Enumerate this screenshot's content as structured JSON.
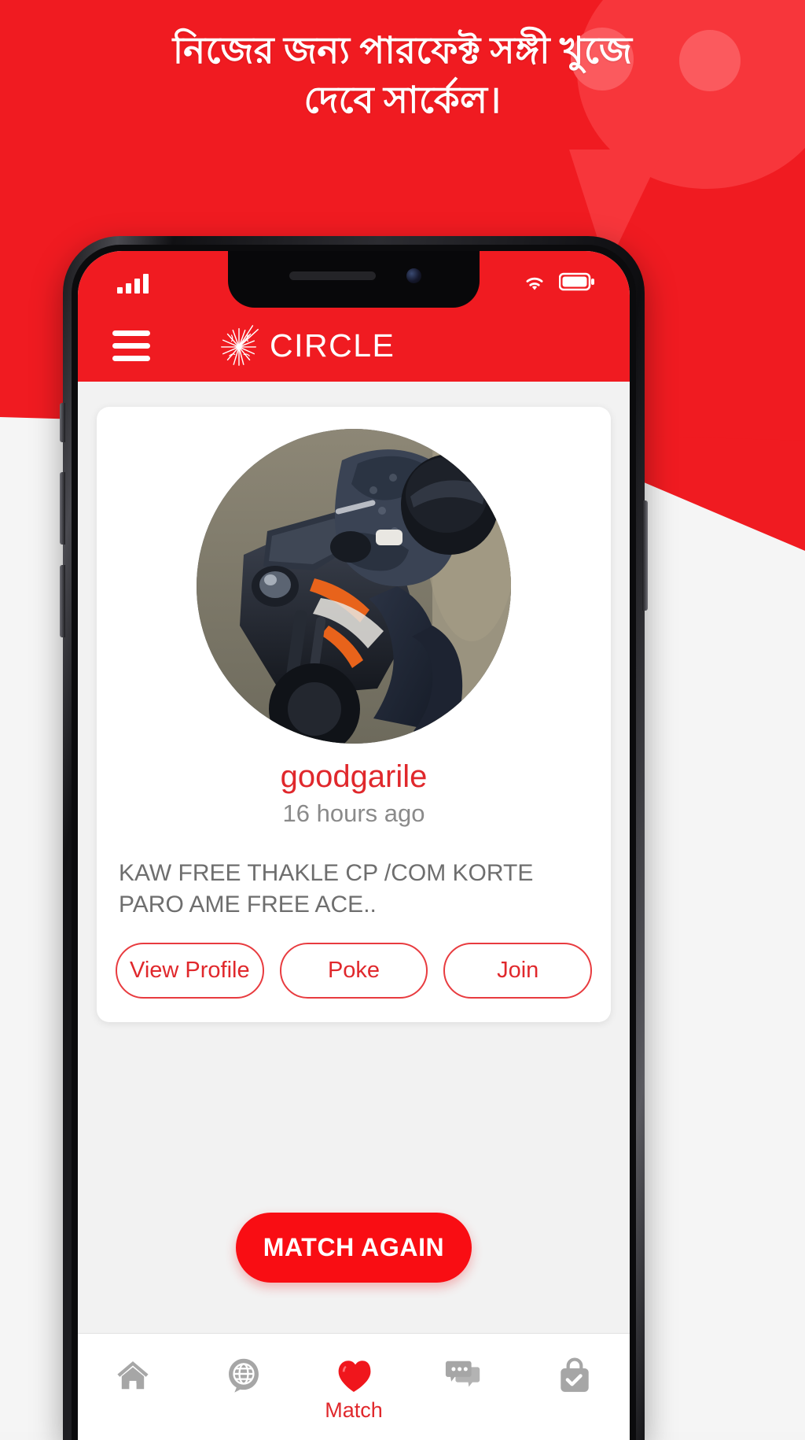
{
  "promo": {
    "headline_line1": "নিজের জন্য পারফেক্ট সঙ্গী খুজে",
    "headline_line2": "দেবে সার্কেল।",
    "background_color": "#f01b21",
    "accent_color": "#e0282c"
  },
  "statusbar": {
    "signal_icon": "signal-bars-icon",
    "wifi_icon": "wifi-icon",
    "battery_icon": "battery-full-icon"
  },
  "appbar": {
    "menu_icon": "hamburger-menu-icon",
    "logo_icon": "circle-starburst-logo-icon",
    "brand_name": "CIRCLE"
  },
  "card": {
    "avatar_alt": "motorcycle-rider-photo",
    "username": "goodgarile",
    "timestamp": "16 hours ago",
    "status_text": "KAW FREE THAKLE CP /COM KORTE PARO AME FREE ACE..",
    "buttons": [
      {
        "label": "View Profile",
        "name": "view-profile-button"
      },
      {
        "label": "Poke",
        "name": "poke-button"
      },
      {
        "label": "Join",
        "name": "join-button"
      }
    ]
  },
  "main_action": {
    "label": "MATCH AGAIN"
  },
  "bottom_nav": [
    {
      "label": "",
      "icon": "home-icon",
      "name": "nav-home",
      "active": false
    },
    {
      "label": "",
      "icon": "globe-bubble-icon",
      "name": "nav-discover",
      "active": false
    },
    {
      "label": "Match",
      "icon": "heart-icon",
      "name": "nav-match",
      "active": true
    },
    {
      "label": "",
      "icon": "chat-bubbles-icon",
      "name": "nav-chat",
      "active": false
    },
    {
      "label": "",
      "icon": "shopping-bag-check-icon",
      "name": "nav-shop",
      "active": false
    }
  ]
}
